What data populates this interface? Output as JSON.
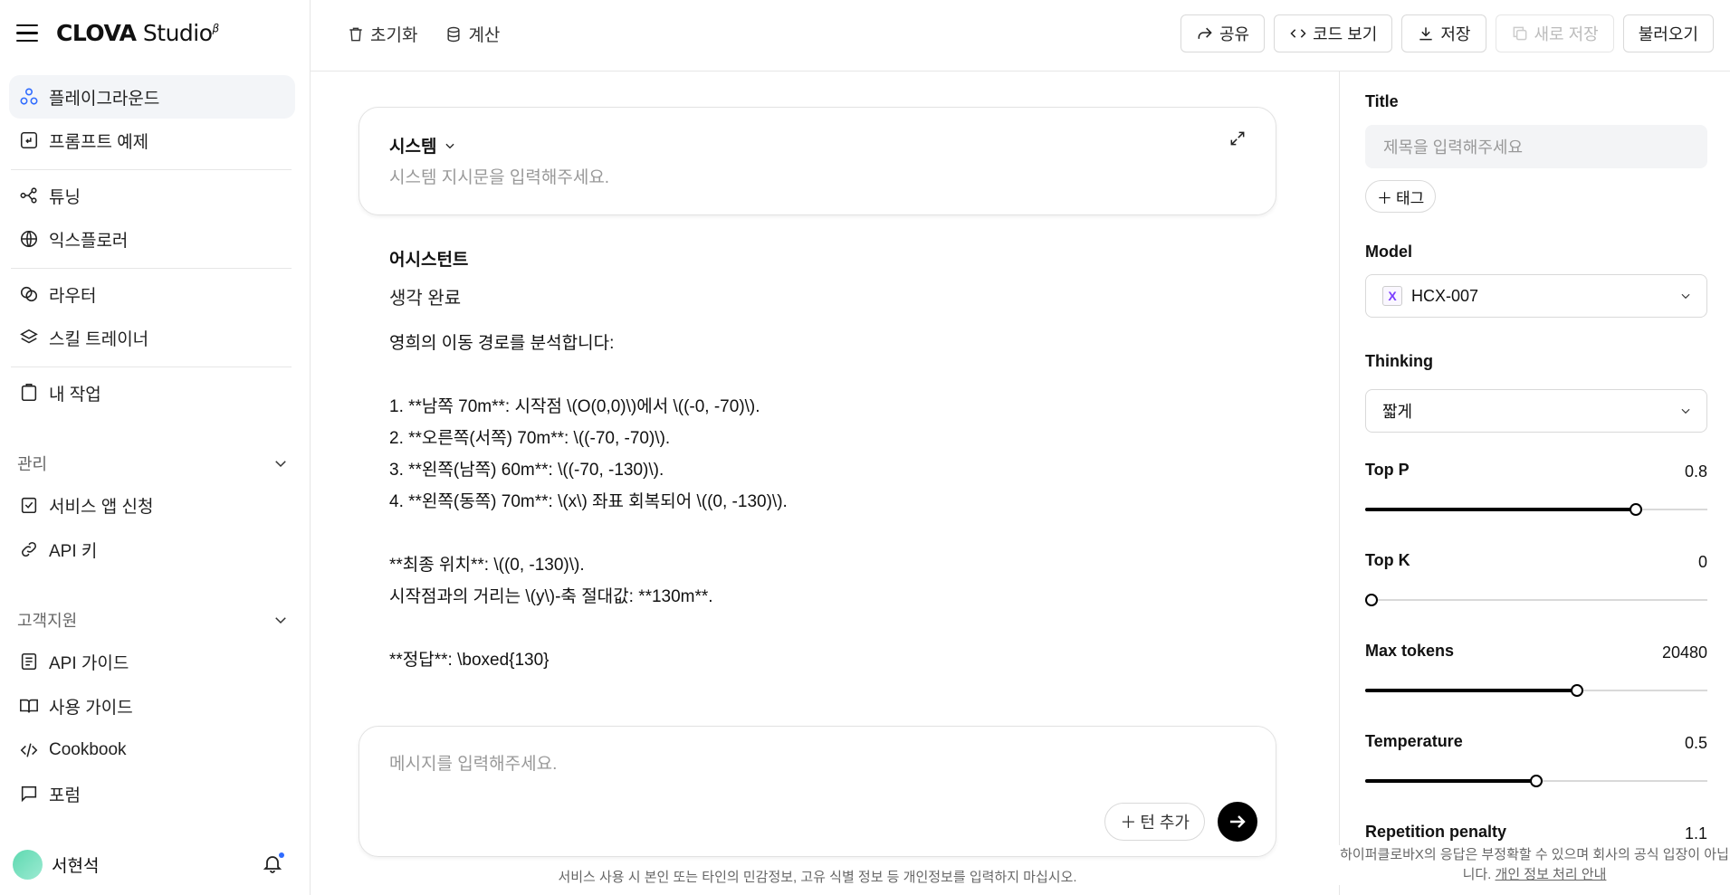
{
  "brand": {
    "name_bold": "CLOVA",
    "name_regular": " Studio",
    "beta": "β"
  },
  "sidebar": {
    "items": [
      {
        "label": "플레이그라운드",
        "icon": "playground-icon"
      },
      {
        "label": "프롬프트 예제",
        "icon": "prompt-example-icon"
      },
      {
        "label": "튜닝",
        "icon": "tuning-icon"
      },
      {
        "label": "익스플로러",
        "icon": "globe-icon"
      },
      {
        "label": "라우터",
        "icon": "router-icon"
      },
      {
        "label": "스킬 트레이너",
        "icon": "layers-icon"
      },
      {
        "label": "내 작업",
        "icon": "clipboard-icon"
      }
    ],
    "section_manage": "관리",
    "manage_items": [
      {
        "label": "서비스 앱 신청",
        "icon": "checklist-icon"
      },
      {
        "label": "API 키",
        "icon": "link-icon"
      }
    ],
    "section_support": "고객지원",
    "support_items": [
      {
        "label": "API 가이드",
        "icon": "document-icon"
      },
      {
        "label": "사용 가이드",
        "icon": "book-icon"
      },
      {
        "label": "Cookbook",
        "icon": "code-icon"
      },
      {
        "label": "포럼",
        "icon": "chat-icon"
      }
    ],
    "user_name": "서현석"
  },
  "toolbar": {
    "reset": "초기화",
    "calc": "계산",
    "share": "공유",
    "view_code": "코드 보기",
    "save": "저장",
    "save_new": "새로 저장",
    "load": "불러오기"
  },
  "system": {
    "title": "시스템",
    "placeholder": "시스템 지시문을 입력해주세요."
  },
  "assistant": {
    "role": "어시스턴트",
    "thinking": "생각 완료",
    "lines": [
      "영희의 이동 경로를 분석합니다:",
      "",
      "1. **남쪽 70m**: 시작점 \\(O(0,0)\\)에서 \\((-0, -70)\\).",
      "2. **오른쪽(서쪽) 70m**: \\((-70, -70)\\).",
      "3. **왼쪽(남쪽) 60m**: \\((-70, -130)\\).",
      "4. **왼쪽(동쪽) 70m**: \\(x\\) 좌표 회복되어 \\((0, -130)\\).",
      "",
      "**최종 위치**: \\((0, -130)\\).",
      "시작점과의 거리는 \\(y\\)-축 절대값: **130m**.",
      "",
      "**정답**: \\boxed{130}"
    ]
  },
  "chat": {
    "placeholder": "메시지를 입력해주세요.",
    "add_turn": "턴 추가",
    "disclaimer": "서비스 사용 시 본인 또는 타인의 민감정보, 고유 식별 정보 등 개인정보를 입력하지 마십시오."
  },
  "settings": {
    "title_label": "Title",
    "title_placeholder": "제목을 입력해주세요",
    "tag_button": "태그",
    "model_label": "Model",
    "model_value": "HCX-007",
    "thinking_label": "Thinking",
    "thinking_value": "짧게",
    "top_p": {
      "label": "Top P",
      "value": "0.8",
      "fraction": 0.79
    },
    "top_k": {
      "label": "Top K",
      "value": "0",
      "fraction": 0.0
    },
    "max_tokens": {
      "label": "Max tokens",
      "value": "20480",
      "fraction": 0.62
    },
    "temperature": {
      "label": "Temperature",
      "value": "0.5",
      "fraction": 0.5
    },
    "repetition_penalty": {
      "label": "Repetition penalty",
      "value": "1.1"
    },
    "note": "하이퍼클로바X의 응답은 부정확할 수 있으며 회사의 공식 입장이 아닙니다.",
    "note_link": "개인 정보 처리 안내"
  }
}
